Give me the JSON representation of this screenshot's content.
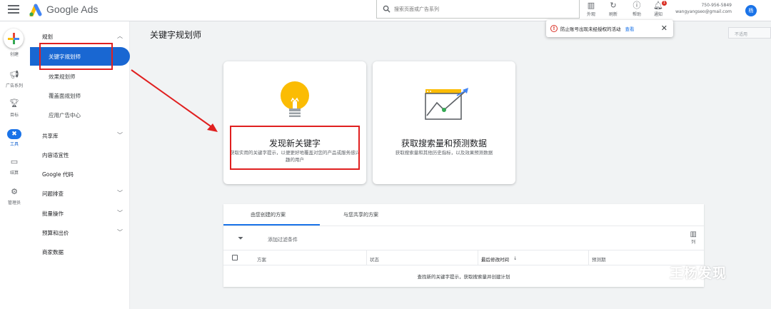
{
  "app": {
    "brand": "Google Ads"
  },
  "search": {
    "placeholder": "搜索页面或广告系列"
  },
  "toolbar": [
    {
      "label": "外观",
      "icon": "appearance-icon"
    },
    {
      "label": "刷新",
      "icon": "refresh-icon"
    },
    {
      "label": "帮助",
      "icon": "help-icon"
    },
    {
      "label": "通知",
      "icon": "bell-icon",
      "badge": "1"
    }
  ],
  "account": {
    "id": "750-956-5849",
    "email": "wangyangseo@gmail.com",
    "avatar": "杨"
  },
  "rail": [
    {
      "label": "创建",
      "icon": "plus-icon"
    },
    {
      "label": "广告系列",
      "icon": "megaphone-icon"
    },
    {
      "label": "目标",
      "icon": "trophy-icon"
    },
    {
      "label": "工具",
      "icon": "tools-icon",
      "active": true
    },
    {
      "label": "结算",
      "icon": "card-icon"
    },
    {
      "label": "管理员",
      "icon": "gear-icon"
    }
  ],
  "sidenav": {
    "section_planning": "规划",
    "items_planning": [
      "关键字规划师",
      "效果规划师",
      "覆盖面规划师",
      "应用广告中心"
    ],
    "active": "关键字规划师",
    "sections": [
      "共享库",
      "内容适宜性",
      "Google 代码",
      "问题排查",
      "批量操作",
      "预算和出价",
      "商家数据"
    ]
  },
  "main": {
    "title": "关键字规划师",
    "toast": {
      "text": "防止账号出现未经授权的活动",
      "link": "查看"
    },
    "date_select": "不适用",
    "card_discover": {
      "title": "发现新关键字",
      "desc": "获取实用的关键字提示，以便更好地覆盖对您的产品或服务感兴趣的用户"
    },
    "card_forecast": {
      "title": "获取搜索量和预测数据",
      "desc": "获取搜索量和其他历史指标，以及效果预测数据"
    },
    "plans": {
      "tabs": [
        "由您创建的方案",
        "与您共享的方案"
      ],
      "filter": "添加过滤条件",
      "columns_label": "列",
      "headers": [
        "方案",
        "状态",
        "最后修改时间",
        "预测期"
      ],
      "sort_indicator": "↓",
      "empty": "查找新的关键字提示，获取搜索量并创建计划"
    }
  },
  "watermark": {
    "text": "王杨发现"
  },
  "colors": {
    "accent": "#1967d2",
    "annotation_red": "#e02020",
    "warning": "#d93025"
  }
}
